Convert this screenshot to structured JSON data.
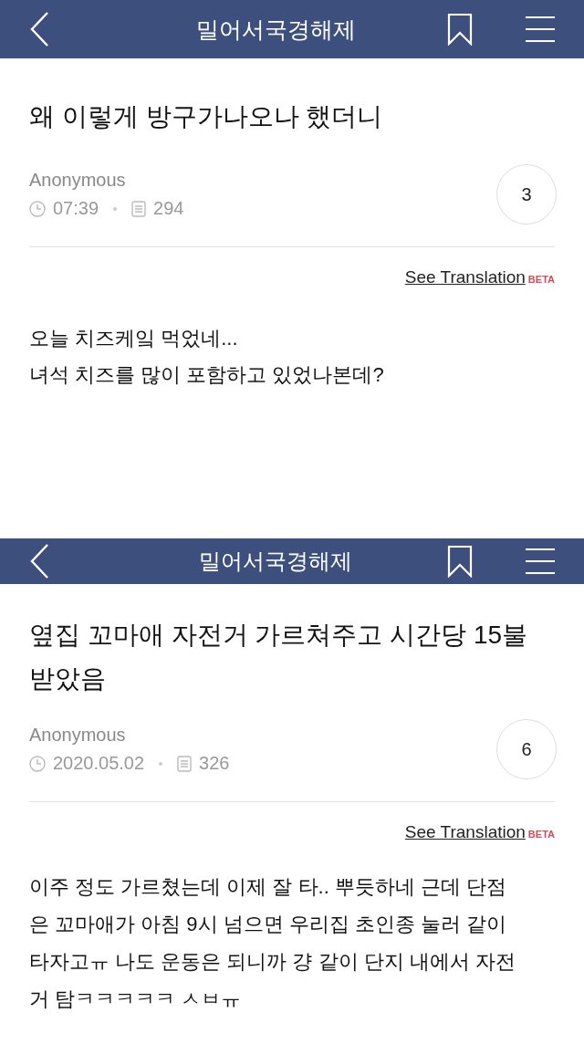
{
  "posts": [
    {
      "header": {
        "title": "밀어서국경해제",
        "cropped": false
      },
      "title": "왜 이렇게 방구가나오나 했더니",
      "author": "Anonymous",
      "time": "07:39",
      "views": "294",
      "comments": "3",
      "translate": "See Translation",
      "beta": "BETA",
      "body": [
        "오늘 치즈케잌 먹었네...",
        "녀석 치즈를 많이 포함하고 있었나본데?"
      ]
    },
    {
      "header": {
        "title": "밀어서국경해제",
        "cropped": true
      },
      "title": "옆집 꼬마애 자전거 가르쳐주고 시간당 15불 받았음",
      "author": "Anonymous",
      "time": "2020.05.02",
      "views": "326",
      "comments": "6",
      "translate": "See Translation",
      "beta": "BETA",
      "body": [
        "이주 정도 가르쳤는데 이제 잘 타.. 뿌듯하네 근데 단점",
        "은 꼬마애가 아침 9시 넘으면 우리집 초인종 눌러 같이",
        "타자고ㅠ 나도 운동은 되니까 걍 같이 단지 내에서 자전",
        "거 탐ㅋㅋㅋㅋㅋ ㅅㅂㅠ"
      ]
    }
  ]
}
